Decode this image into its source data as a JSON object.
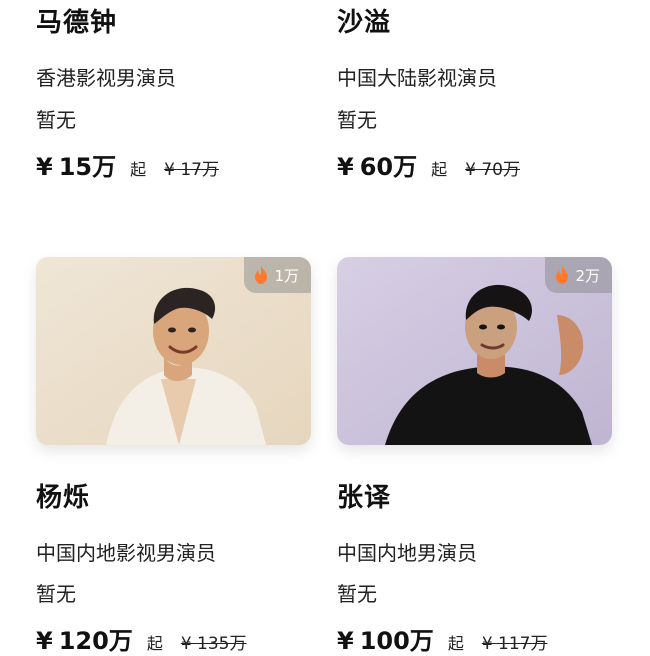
{
  "cards": [
    {
      "name": "马德钟",
      "role": "香港影视男演员",
      "works": "暂无",
      "price": "15万",
      "currency": "¥",
      "from": "起",
      "original_price": "¥ 17万"
    },
    {
      "name": "沙溢",
      "role": "中国大陆影视演员",
      "works": "暂无",
      "price": "60万",
      "currency": "¥",
      "from": "起",
      "original_price": "¥ 70万"
    },
    {
      "name": "杨烁",
      "role": "中国内地影视男演员",
      "works": "暂无",
      "price": "120万",
      "currency": "¥",
      "from": "起",
      "original_price": "¥ 135万",
      "heat": "1万",
      "heat_icon": "flame-icon"
    },
    {
      "name": "张译",
      "role": "中国内地男演员",
      "works": "暂无",
      "price": "100万",
      "currency": "¥",
      "from": "起",
      "original_price": "¥ 117万",
      "heat": "2万",
      "heat_icon": "flame-icon"
    }
  ],
  "colors": {
    "text": "#111111",
    "flame": "#ff7a2e",
    "heat_badge_bg": "rgba(130,130,130,0.45)"
  }
}
